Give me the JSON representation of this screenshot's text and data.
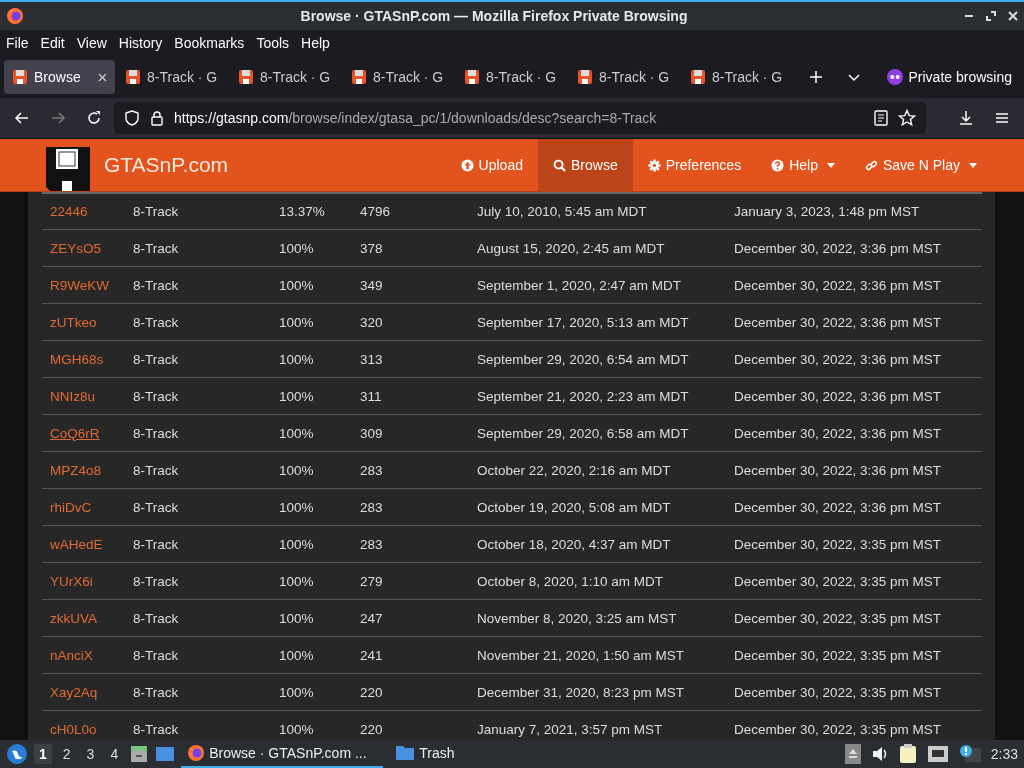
{
  "window": {
    "title": "Browse · GTASnP.com — Mozilla Firefox Private Browsing"
  },
  "menu": [
    "File",
    "Edit",
    "View",
    "History",
    "Bookmarks",
    "Tools",
    "Help"
  ],
  "tabs": [
    {
      "label": "Browse",
      "selected": true
    },
    {
      "label": "8-Track · G",
      "selected": false
    },
    {
      "label": "8-Track · G",
      "selected": false
    },
    {
      "label": "8-Track · G",
      "selected": false
    },
    {
      "label": "8-Track · G",
      "selected": false
    },
    {
      "label": "8-Track · G",
      "selected": false
    },
    {
      "label": "8-Track · G",
      "selected": false
    }
  ],
  "private_label": "Private browsing",
  "url": {
    "host": "https://gtasnp.com",
    "path": "/browse/index/gtasa_pc/1/downloads/desc?search=8-Track"
  },
  "site": {
    "name": "GTASnP.com",
    "nav": [
      {
        "label": "Upload",
        "kind": "upload",
        "dropdown": false,
        "selected": false
      },
      {
        "label": "Browse",
        "kind": "search",
        "dropdown": false,
        "selected": true
      },
      {
        "label": "Preferences",
        "kind": "gear",
        "dropdown": false,
        "selected": false
      },
      {
        "label": "Help",
        "kind": "help",
        "dropdown": true,
        "selected": false
      },
      {
        "label": "Save N Play",
        "kind": "link",
        "dropdown": true,
        "selected": false
      }
    ]
  },
  "table": {
    "rows": [
      {
        "id": "22446",
        "name": "8-Track",
        "progress": "13.37%",
        "downloads": "4796",
        "created": "July 10, 2010, 5:45 am MDT",
        "updated": "January 3, 2023, 1:48 pm MST",
        "hovered": false
      },
      {
        "id": "ZEYsO5",
        "name": "8-Track",
        "progress": "100%",
        "downloads": "378",
        "created": "August 15, 2020, 2:45 am MDT",
        "updated": "December 30, 2022, 3:36 pm MST",
        "hovered": false
      },
      {
        "id": "R9WeKW",
        "name": "8-Track",
        "progress": "100%",
        "downloads": "349",
        "created": "September 1, 2020, 2:47 am MDT",
        "updated": "December 30, 2022, 3:36 pm MST",
        "hovered": false
      },
      {
        "id": "zUTkeo",
        "name": "8-Track",
        "progress": "100%",
        "downloads": "320",
        "created": "September 17, 2020, 5:13 am MDT",
        "updated": "December 30, 2022, 3:36 pm MST",
        "hovered": false
      },
      {
        "id": "MGH68s",
        "name": "8-Track",
        "progress": "100%",
        "downloads": "313",
        "created": "September 29, 2020, 6:54 am MDT",
        "updated": "December 30, 2022, 3:36 pm MST",
        "hovered": false
      },
      {
        "id": "NNIz8u",
        "name": "8-Track",
        "progress": "100%",
        "downloads": "311",
        "created": "September 21, 2020, 2:23 am MDT",
        "updated": "December 30, 2022, 3:36 pm MST",
        "hovered": false
      },
      {
        "id": "CoQ6rR",
        "name": "8-Track",
        "progress": "100%",
        "downloads": "309",
        "created": "September 29, 2020, 6:58 am MDT",
        "updated": "December 30, 2022, 3:36 pm MST",
        "hovered": true
      },
      {
        "id": "MPZ4o8",
        "name": "8-Track",
        "progress": "100%",
        "downloads": "283",
        "created": "October 22, 2020, 2:16 am MDT",
        "updated": "December 30, 2022, 3:36 pm MST",
        "hovered": false
      },
      {
        "id": "rhiDvC",
        "name": "8-Track",
        "progress": "100%",
        "downloads": "283",
        "created": "October 19, 2020, 5:08 am MDT",
        "updated": "December 30, 2022, 3:36 pm MST",
        "hovered": false
      },
      {
        "id": "wAHedE",
        "name": "8-Track",
        "progress": "100%",
        "downloads": "283",
        "created": "October 18, 2020, 4:37 am MDT",
        "updated": "December 30, 2022, 3:35 pm MST",
        "hovered": false
      },
      {
        "id": "YUrX6i",
        "name": "8-Track",
        "progress": "100%",
        "downloads": "279",
        "created": "October 8, 2020, 1:10 am MDT",
        "updated": "December 30, 2022, 3:35 pm MST",
        "hovered": false
      },
      {
        "id": "zkkUVA",
        "name": "8-Track",
        "progress": "100%",
        "downloads": "247",
        "created": "November 8, 2020, 3:25 am MST",
        "updated": "December 30, 2022, 3:35 pm MST",
        "hovered": false
      },
      {
        "id": "nAnciX",
        "name": "8-Track",
        "progress": "100%",
        "downloads": "241",
        "created": "November 21, 2020, 1:50 am MST",
        "updated": "December 30, 2022, 3:35 pm MST",
        "hovered": false
      },
      {
        "id": "Xay2Aq",
        "name": "8-Track",
        "progress": "100%",
        "downloads": "220",
        "created": "December 31, 2020, 8:23 pm MST",
        "updated": "December 30, 2022, 3:35 pm MST",
        "hovered": false
      },
      {
        "id": "cH0L0o",
        "name": "8-Track",
        "progress": "100%",
        "downloads": "220",
        "created": "January 7, 2021, 3:57 pm MST",
        "updated": "December 30, 2022, 3:35 pm MST",
        "hovered": false
      }
    ]
  },
  "taskbar": {
    "workspaces": [
      {
        "label": "1",
        "selected": true
      },
      {
        "label": "2",
        "selected": false
      },
      {
        "label": "3",
        "selected": false
      },
      {
        "label": "4",
        "selected": false
      }
    ],
    "windows": [
      {
        "label": "Browse · GTASnP.com ...",
        "kind": "firefox",
        "selected": true
      },
      {
        "label": "Trash",
        "kind": "folder",
        "selected": false
      }
    ],
    "clock": "2:33"
  }
}
